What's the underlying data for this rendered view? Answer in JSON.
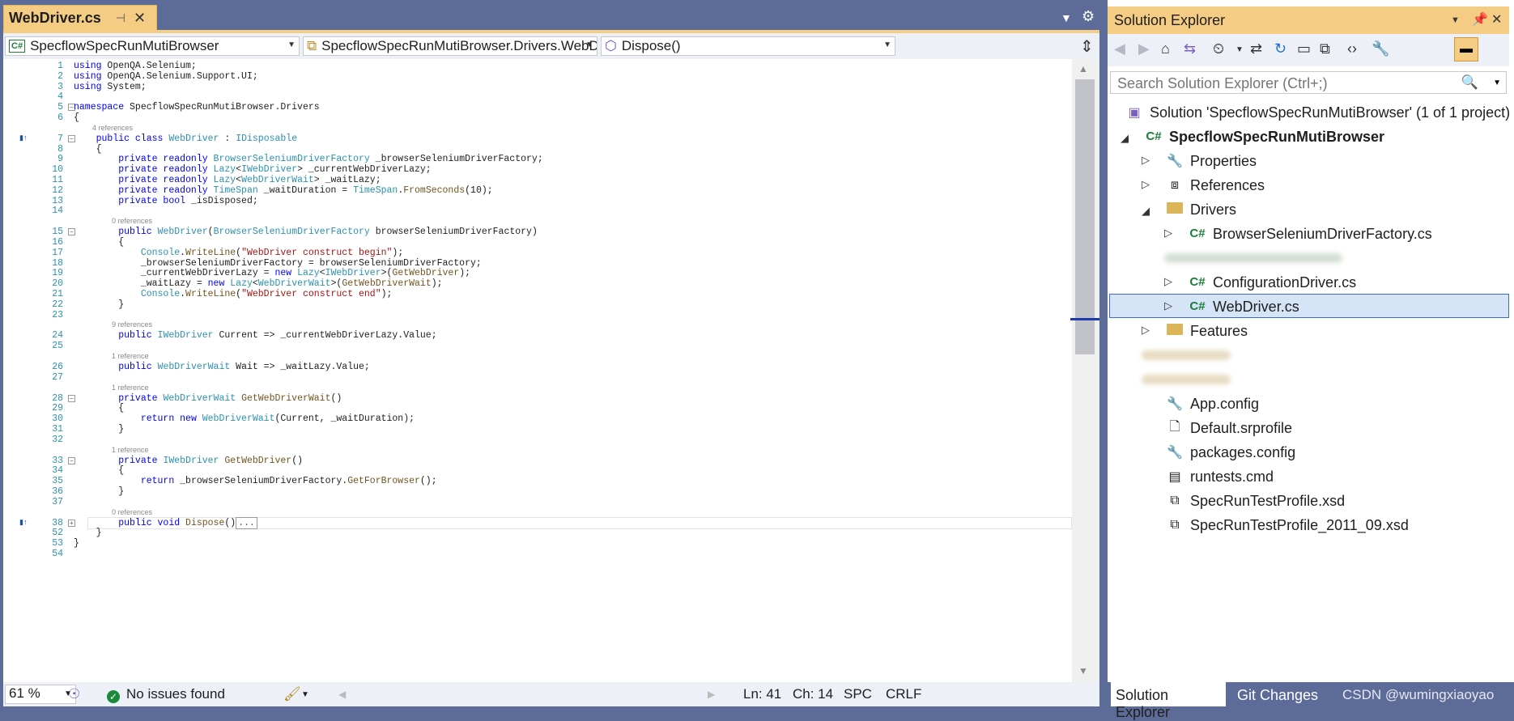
{
  "editor": {
    "tab_title": "WebDriver.cs",
    "tab_pin": "⊣",
    "tab_close": "✕",
    "overflow": "▼",
    "gear": "⚙",
    "project_combo": "SpecflowSpecRunMutiBrowser",
    "class_combo": "SpecflowSpecRunMutiBrowser.Drivers.WebDriver",
    "member_combo": "Dispose()",
    "split": "⇕",
    "collapsed_ellipsis": "..."
  },
  "code_lines": [
    {
      "n": "1",
      "segs": [
        [
          "kw",
          "using"
        ],
        [
          "",
          " OpenQA.Selenium;"
        ]
      ]
    },
    {
      "n": "2",
      "segs": [
        [
          "kw",
          "using"
        ],
        [
          "",
          " OpenQA.Selenium.Support.UI;"
        ]
      ]
    },
    {
      "n": "3",
      "segs": [
        [
          "kw",
          "using"
        ],
        [
          "",
          " System;"
        ]
      ]
    },
    {
      "n": "4",
      "segs": []
    },
    {
      "n": "5",
      "segs": [
        [
          "kw",
          "namespace"
        ],
        [
          "",
          " SpecflowSpecRunMutiBrowser.Drivers"
        ]
      ]
    },
    {
      "n": "6",
      "segs": [
        [
          "",
          "{"
        ]
      ]
    },
    {
      "n": "7",
      "segs": [
        [
          "",
          "    "
        ],
        [
          "kw",
          "public class"
        ],
        [
          "",
          " "
        ],
        [
          "ty",
          "WebDriver"
        ],
        [
          "",
          " : "
        ],
        [
          "ty",
          "IDisposable"
        ]
      ]
    },
    {
      "n": "8",
      "segs": [
        [
          "",
          "    {"
        ]
      ]
    },
    {
      "n": "9",
      "segs": [
        [
          "",
          "        "
        ],
        [
          "kw",
          "private readonly"
        ],
        [
          "",
          " "
        ],
        [
          "ty",
          "BrowserSeleniumDriverFactory"
        ],
        [
          "",
          " _browserSeleniumDriverFactory;"
        ]
      ]
    },
    {
      "n": "10",
      "segs": [
        [
          "",
          "        "
        ],
        [
          "kw",
          "private readonly"
        ],
        [
          "",
          " "
        ],
        [
          "ty",
          "Lazy"
        ],
        [
          "",
          "<"
        ],
        [
          "ty",
          "IWebDriver"
        ],
        [
          "",
          "> _currentWebDriverLazy;"
        ]
      ]
    },
    {
      "n": "11",
      "segs": [
        [
          "",
          "        "
        ],
        [
          "kw",
          "private readonly"
        ],
        [
          "",
          " "
        ],
        [
          "ty",
          "Lazy"
        ],
        [
          "",
          "<"
        ],
        [
          "ty",
          "WebDriverWait"
        ],
        [
          "",
          "> _waitLazy;"
        ]
      ]
    },
    {
      "n": "12",
      "segs": [
        [
          "",
          "        "
        ],
        [
          "kw",
          "private readonly"
        ],
        [
          "",
          " "
        ],
        [
          "ty",
          "TimeSpan"
        ],
        [
          "",
          " _waitDuration = "
        ],
        [
          "ty",
          "TimeSpan"
        ],
        [
          "",
          "."
        ],
        [
          "mt",
          "FromSeconds"
        ],
        [
          "",
          "(10);"
        ]
      ]
    },
    {
      "n": "13",
      "segs": [
        [
          "",
          "        "
        ],
        [
          "kw",
          "private bool"
        ],
        [
          "",
          " _isDisposed;"
        ]
      ]
    },
    {
      "n": "14",
      "segs": []
    },
    {
      "n": "15",
      "segs": [
        [
          "",
          "        "
        ],
        [
          "kw",
          "public"
        ],
        [
          "",
          " "
        ],
        [
          "ty",
          "WebDriver"
        ],
        [
          "",
          "("
        ],
        [
          "ty",
          "BrowserSeleniumDriverFactory"
        ],
        [
          "",
          " browserSeleniumDriverFactory)"
        ]
      ]
    },
    {
      "n": "16",
      "segs": [
        [
          "",
          "        {"
        ]
      ]
    },
    {
      "n": "17",
      "segs": [
        [
          "",
          "            "
        ],
        [
          "ty",
          "Console"
        ],
        [
          "",
          "."
        ],
        [
          "mt",
          "WriteLine"
        ],
        [
          "",
          "("
        ],
        [
          "st",
          "\"WebDriver construct begin\""
        ],
        [
          "",
          ");"
        ]
      ]
    },
    {
      "n": "18",
      "segs": [
        [
          "",
          "            _browserSeleniumDriverFactory = browserSeleniumDriverFactory;"
        ]
      ]
    },
    {
      "n": "19",
      "segs": [
        [
          "",
          "            _currentWebDriverLazy = "
        ],
        [
          "kw",
          "new"
        ],
        [
          "",
          " "
        ],
        [
          "ty",
          "Lazy"
        ],
        [
          "",
          "<"
        ],
        [
          "ty",
          "IWebDriver"
        ],
        [
          "",
          ">("
        ],
        [
          "mt",
          "GetWebDriver"
        ],
        [
          "",
          ");"
        ]
      ]
    },
    {
      "n": "20",
      "segs": [
        [
          "",
          "            _waitLazy = "
        ],
        [
          "kw",
          "new"
        ],
        [
          "",
          " "
        ],
        [
          "ty",
          "Lazy"
        ],
        [
          "",
          "<"
        ],
        [
          "ty",
          "WebDriverWait"
        ],
        [
          "",
          ">("
        ],
        [
          "mt",
          "GetWebDriverWait"
        ],
        [
          "",
          ");"
        ]
      ]
    },
    {
      "n": "21",
      "segs": [
        [
          "",
          "            "
        ],
        [
          "ty",
          "Console"
        ],
        [
          "",
          "."
        ],
        [
          "mt",
          "WriteLine"
        ],
        [
          "",
          "("
        ],
        [
          "st",
          "\"WebDriver construct end\""
        ],
        [
          "",
          ");"
        ]
      ]
    },
    {
      "n": "22",
      "segs": [
        [
          "",
          "        }"
        ]
      ]
    },
    {
      "n": "23",
      "segs": []
    },
    {
      "n": "24",
      "segs": [
        [
          "",
          "        "
        ],
        [
          "kw",
          "public"
        ],
        [
          "",
          " "
        ],
        [
          "ty",
          "IWebDriver"
        ],
        [
          "",
          " Current => _currentWebDriverLazy.Value;"
        ]
      ]
    },
    {
      "n": "25",
      "segs": []
    },
    {
      "n": "26",
      "segs": [
        [
          "",
          "        "
        ],
        [
          "kw",
          "public"
        ],
        [
          "",
          " "
        ],
        [
          "ty",
          "WebDriverWait"
        ],
        [
          "",
          " Wait => _waitLazy.Value;"
        ]
      ]
    },
    {
      "n": "27",
      "segs": []
    },
    {
      "n": "28",
      "segs": [
        [
          "",
          "        "
        ],
        [
          "kw",
          "private"
        ],
        [
          "",
          " "
        ],
        [
          "ty",
          "WebDriverWait"
        ],
        [
          "",
          " "
        ],
        [
          "mt",
          "GetWebDriverWait"
        ],
        [
          "",
          "()"
        ]
      ]
    },
    {
      "n": "29",
      "segs": [
        [
          "",
          "        {"
        ]
      ]
    },
    {
      "n": "30",
      "segs": [
        [
          "",
          "            "
        ],
        [
          "kw",
          "return new"
        ],
        [
          "",
          " "
        ],
        [
          "ty",
          "WebDriverWait"
        ],
        [
          "",
          "(Current, _waitDuration);"
        ]
      ]
    },
    {
      "n": "31",
      "segs": [
        [
          "",
          "        }"
        ]
      ]
    },
    {
      "n": "32",
      "segs": []
    },
    {
      "n": "33",
      "segs": [
        [
          "",
          "        "
        ],
        [
          "kw",
          "private"
        ],
        [
          "",
          " "
        ],
        [
          "ty",
          "IWebDriver"
        ],
        [
          "",
          " "
        ],
        [
          "mt",
          "GetWebDriver"
        ],
        [
          "",
          "()"
        ]
      ]
    },
    {
      "n": "34",
      "segs": [
        [
          "",
          "        {"
        ]
      ]
    },
    {
      "n": "35",
      "segs": [
        [
          "",
          "            "
        ],
        [
          "kw",
          "return"
        ],
        [
          "",
          " _browserSeleniumDriverFactory."
        ],
        [
          "mt",
          "GetForBrowser"
        ],
        [
          "",
          "();"
        ]
      ]
    },
    {
      "n": "36",
      "segs": [
        [
          "",
          "        }"
        ]
      ]
    },
    {
      "n": "37",
      "segs": []
    },
    {
      "n": "38",
      "segs": [
        [
          "",
          "        "
        ],
        [
          "kw",
          "public void"
        ],
        [
          "",
          " "
        ],
        [
          "mt",
          "Dispose"
        ],
        [
          "",
          "()"
        ]
      ]
    },
    {
      "n": "52",
      "segs": [
        [
          "",
          "    }"
        ]
      ]
    },
    {
      "n": "53",
      "segs": [
        [
          "",
          "}"
        ]
      ]
    },
    {
      "n": "54",
      "segs": []
    }
  ],
  "code_lens": [
    {
      "after_line": "6",
      "text": "4 references"
    },
    {
      "after_line": "14",
      "text": "0 references"
    },
    {
      "after_line": "23",
      "text": "9 references"
    },
    {
      "after_line": "25",
      "text": "1 reference"
    },
    {
      "after_line": "27",
      "text": "1 reference"
    },
    {
      "after_line": "32",
      "text": "1 reference"
    },
    {
      "after_line": "37",
      "text": "0 references"
    }
  ],
  "status": {
    "zoom": "61 %",
    "issues": "No issues found",
    "ln": "Ln: 41",
    "ch": "Ch: 14",
    "spc": "SPC",
    "crlf": "CRLF"
  },
  "solution_explorer": {
    "title": "Solution Explorer",
    "search_placeholder": "Search Solution Explorer (Ctrl+;)",
    "solution": "Solution 'SpecflowSpecRunMutiBrowser' (1 of 1 project)",
    "project": "SpecflowSpecRunMutiBrowser",
    "items": {
      "properties": "Properties",
      "references": "References",
      "drivers": "Drivers",
      "browser_factory": "BrowserSeleniumDriverFactory.cs",
      "configuration_driver": "ConfigurationDriver.cs",
      "webdriver": "WebDriver.cs",
      "features": "Features",
      "app_config": "App.config",
      "default_srprofile": "Default.srprofile",
      "packages_config": "packages.config",
      "runtests": "runtests.cmd",
      "specrun_xsd": "SpecRunTestProfile.xsd",
      "specrun_2011_xsd": "SpecRunTestProfile_2011_09.xsd"
    },
    "bottom_tabs": {
      "solution_explorer": "Solution Explorer",
      "git_changes": "Git Changes"
    },
    "watermark": "CSDN @wumingxiaoyao"
  },
  "colors": {
    "accent": "#f5cc84",
    "chrome": "#5d6b99",
    "keyword": "#0000ff",
    "type": "#2b91af",
    "string": "#a31515"
  }
}
